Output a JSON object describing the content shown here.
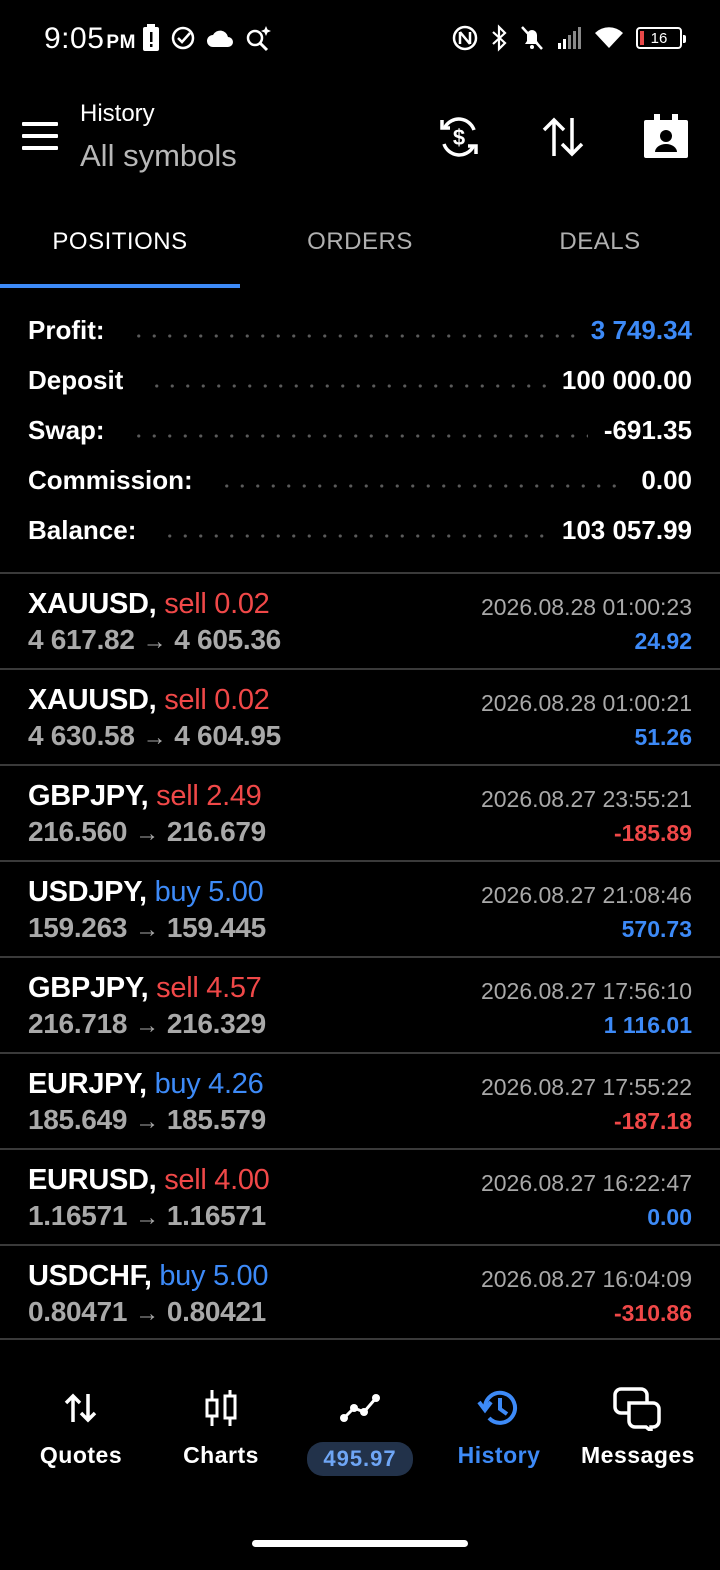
{
  "status_bar": {
    "time": "9:05",
    "ampm": "PM",
    "battery": "16"
  },
  "header": {
    "title": "History",
    "subtitle": "All symbols"
  },
  "tabs": [
    {
      "label": "POSITIONS",
      "active": true
    },
    {
      "label": "ORDERS",
      "active": false
    },
    {
      "label": "DEALS",
      "active": false
    }
  ],
  "summary": {
    "profit": {
      "label": "Profit:",
      "value": "3 749.34"
    },
    "deposit": {
      "label": "Deposit",
      "value": "100 000.00"
    },
    "swap": {
      "label": "Swap:",
      "value": "-691.35"
    },
    "commission": {
      "label": "Commission:",
      "value": "0.00"
    },
    "balance": {
      "label": "Balance:",
      "value": "103 057.99"
    }
  },
  "deals": [
    {
      "symbol": "XAUUSD,",
      "side": "sell 0.02",
      "type": "sell",
      "open": "4 617.82",
      "close": "4 605.36",
      "datetime": "2026.08.28 01:00:23",
      "profit": "24.92",
      "sign": "pos"
    },
    {
      "symbol": "XAUUSD,",
      "side": "sell 0.02",
      "type": "sell",
      "open": "4 630.58",
      "close": "4 604.95",
      "datetime": "2026.08.28 01:00:21",
      "profit": "51.26",
      "sign": "pos"
    },
    {
      "symbol": "GBPJPY,",
      "side": "sell 2.49",
      "type": "sell",
      "open": "216.560",
      "close": "216.679",
      "datetime": "2026.08.27 23:55:21",
      "profit": "-185.89",
      "sign": "neg"
    },
    {
      "symbol": "USDJPY,",
      "side": "buy 5.00",
      "type": "buy",
      "open": "159.263",
      "close": "159.445",
      "datetime": "2026.08.27 21:08:46",
      "profit": "570.73",
      "sign": "pos"
    },
    {
      "symbol": "GBPJPY,",
      "side": "sell 4.57",
      "type": "sell",
      "open": "216.718",
      "close": "216.329",
      "datetime": "2026.08.27 17:56:10",
      "profit": "1 116.01",
      "sign": "pos"
    },
    {
      "symbol": "EURJPY,",
      "side": "buy 4.26",
      "type": "buy",
      "open": "185.649",
      "close": "185.579",
      "datetime": "2026.08.27 17:55:22",
      "profit": "-187.18",
      "sign": "neg"
    },
    {
      "symbol": "EURUSD,",
      "side": "sell 4.00",
      "type": "sell",
      "open": "1.16571",
      "close": "1.16571",
      "datetime": "2026.08.27 16:22:47",
      "profit": "0.00",
      "sign": "pos"
    },
    {
      "symbol": "USDCHF,",
      "side": "buy 5.00",
      "type": "buy",
      "open": "0.80471",
      "close": "0.80421",
      "datetime": "2026.08.27 16:04:09",
      "profit": "-310.86",
      "sign": "neg"
    }
  ],
  "bottom_nav": {
    "quotes": "Quotes",
    "charts": "Charts",
    "trade_value": "495.97",
    "history": "History",
    "messages": "Messages"
  },
  "colors": {
    "accent": "#3d8af7",
    "sell": "#f04848",
    "muted": "#a9a9a9",
    "background": "#000000"
  }
}
